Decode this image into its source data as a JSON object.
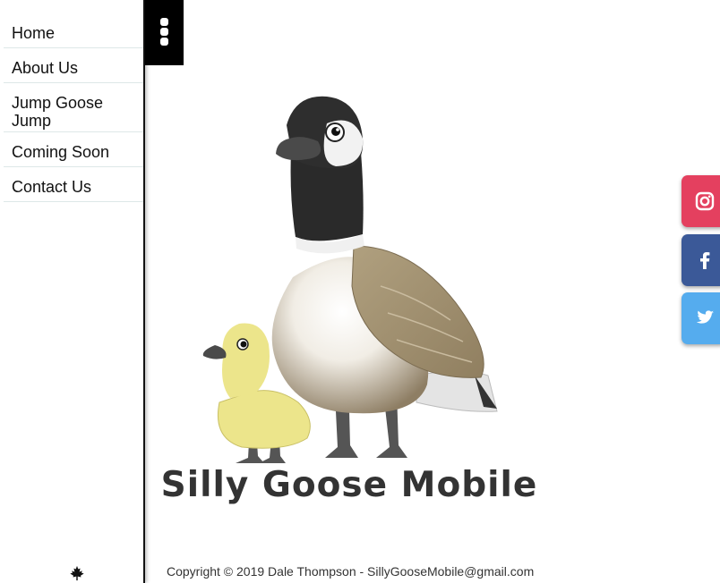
{
  "nav": {
    "items": [
      {
        "label": "Home"
      },
      {
        "label": "About Us"
      },
      {
        "label": "Jump Goose Jump"
      },
      {
        "label": "Coming Soon"
      },
      {
        "label": "Contact Us"
      }
    ]
  },
  "logo": {
    "text": "Silly Goose Mobile"
  },
  "social": {
    "instagram_icon": "instagram-icon",
    "facebook_icon": "facebook-icon",
    "twitter_icon": "twitter-icon",
    "colors": {
      "instagram": "#e4405f",
      "facebook": "#3b5998",
      "twitter": "#55acee"
    }
  },
  "footer": {
    "copyright": "Copyright © 2019 Dale Thompson - SillyGooseMobile@gmail.com"
  }
}
